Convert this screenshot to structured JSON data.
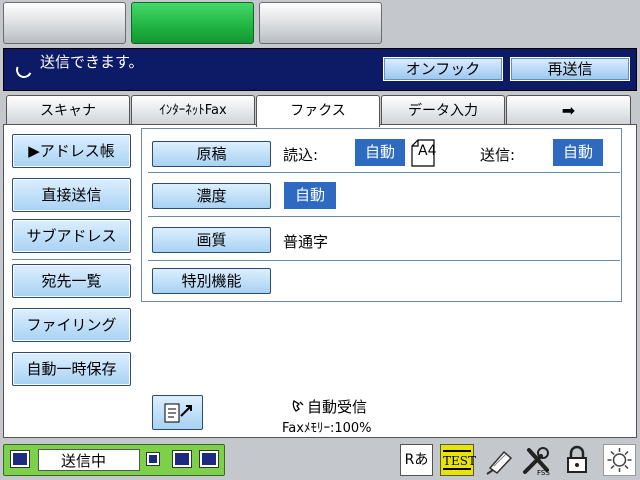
{
  "status": {
    "message": "送信できます。",
    "buttons": {
      "on_hook": "オンフック",
      "resend": "再送信"
    }
  },
  "tabs": [
    {
      "label": "スキャナ"
    },
    {
      "label": "ｲﾝﾀｰﾈｯﾄFax"
    },
    {
      "label": "ファクス"
    },
    {
      "label": "データ入力"
    },
    {
      "label": "➡"
    }
  ],
  "left_buttons": {
    "address_book": "▶アドレス帳",
    "direct_send": "直接送信",
    "sub_address": "サブアドレス",
    "destination_list": "宛先一覧",
    "filing": "ファイリング",
    "auto_temp_save": "自動一時保存"
  },
  "settings": {
    "original": {
      "label": "原稿",
      "read_label": "読込:",
      "read_value": "自動",
      "paper": "A4",
      "send_label": "送信:",
      "send_value": "自動"
    },
    "density": {
      "label": "濃度",
      "value": "自動"
    },
    "quality": {
      "label": "画質",
      "value": "普通字"
    },
    "special": {
      "label": "特別機能"
    }
  },
  "footer": {
    "auto_receive": "自動受信",
    "fax_memory": "Faxﾒﾓﾘｰ:100%"
  },
  "bottom": {
    "job_status": "送信中",
    "input_mode": "Rあ",
    "test_label": "TEST"
  },
  "colors": {
    "status_bg": "#0d1a66",
    "active_mode": "#1fb33f",
    "value_bg": "#2d6ac0",
    "led_green": "#7dd04a"
  }
}
